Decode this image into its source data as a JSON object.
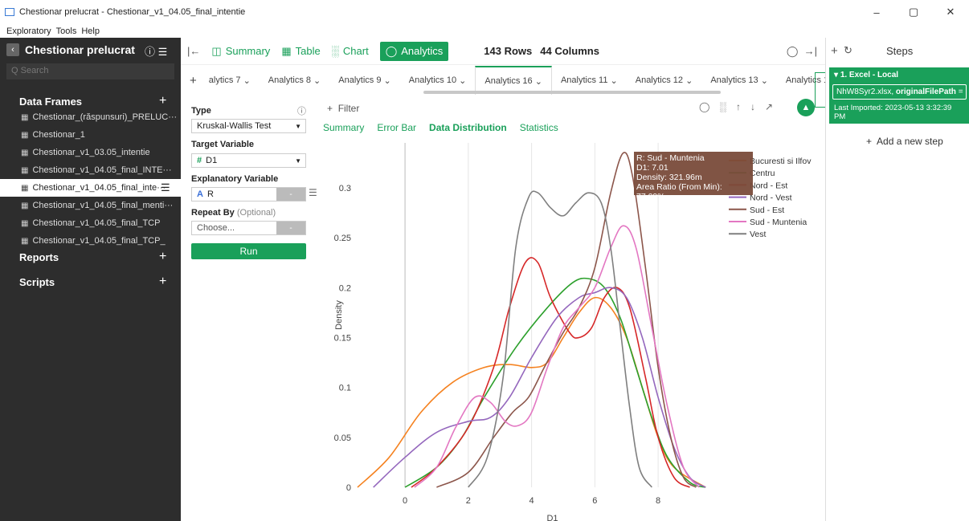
{
  "window": {
    "title": "Chestionar prelucrat - Chestionar_v1_04.05_final_intentie",
    "min": "–",
    "max": "▢",
    "close": "✕"
  },
  "menu": [
    "Exploratory",
    "Tools",
    "Help"
  ],
  "sidebar": {
    "project": "Chestionar prelucrat",
    "search_placeholder": "Q Search",
    "data_frames_label": "Data Frames",
    "reports_label": "Reports",
    "scripts_label": "Scripts",
    "items": [
      "Chestionar_(răspunsuri)_PRELUC···",
      "Chestionar_1",
      "Chestionar_v1_03.05_intentie",
      "Chestionar_v1_04.05_final_INTE···",
      "Chestionar_v1_04.05_final_inte···",
      "Chestionar_v1_04.05_final_menti···",
      "Chestionar_v1_04.05_final_TCP",
      "Chestionar_v1_04.05_final_TCP_"
    ]
  },
  "toolbar": {
    "summary": "Summary",
    "table": "Table",
    "chart": "Chart",
    "analytics": "Analytics",
    "rows": "143 Rows",
    "cols": "44 Columns"
  },
  "tabs": [
    "alytics 7",
    "Analytics 8",
    "Analytics 9",
    "Analytics 10",
    "Analytics 16",
    "Analytics 11",
    "Analytics 12",
    "Analytics 13",
    "Analytics 14"
  ],
  "config": {
    "type_label": "Type",
    "type_value": "Kruskal-Wallis Test",
    "target_label": "Target Variable",
    "target_value": "D1",
    "explanatory_label": "Explanatory Variable",
    "explanatory_value": "R",
    "repeat_label": "Repeat By",
    "repeat_optional": "(Optional)",
    "repeat_placeholder": "Choose...",
    "run_label": "Run"
  },
  "chart_header": {
    "filter": "Filter",
    "subtabs": [
      "Summary",
      "Error Bar",
      "Data Distribution",
      "Statistics"
    ]
  },
  "tooltip": {
    "line1": "R: Sud - Muntenia",
    "line2": "D1: 7.01",
    "line3": "Density: 321.96m",
    "line4": "Area Ratio (From Min): 77.09%"
  },
  "chart_data": {
    "type": "line",
    "xlabel": "D1",
    "ylabel": "Density",
    "xlim": [
      -1.5,
      9.8
    ],
    "ylim": [
      0,
      0.345
    ],
    "xticks": [
      0,
      2,
      4,
      6,
      8
    ],
    "yticks": [
      0,
      0.05,
      0.1,
      0.15,
      0.2,
      0.25,
      0.3
    ],
    "series": [
      {
        "name": "Bucuresti si Ilfov",
        "color": "#f58220",
        "points": [
          [
            -1.5,
            0.0
          ],
          [
            -0.5,
            0.03
          ],
          [
            0.5,
            0.075
          ],
          [
            1.5,
            0.105
          ],
          [
            2.5,
            0.12
          ],
          [
            3.3,
            0.123
          ],
          [
            4,
            0.12
          ],
          [
            4.5,
            0.125
          ],
          [
            5,
            0.15
          ],
          [
            5.5,
            0.175
          ],
          [
            6,
            0.19
          ],
          [
            6.5,
            0.18
          ],
          [
            7,
            0.15
          ],
          [
            7.5,
            0.1
          ],
          [
            8,
            0.05
          ],
          [
            8.5,
            0.02
          ],
          [
            9.5,
            0.0
          ]
        ]
      },
      {
        "name": "Centru",
        "color": "#2ca02c",
        "points": [
          [
            0,
            0.0
          ],
          [
            1,
            0.02
          ],
          [
            1.8,
            0.05
          ],
          [
            2.5,
            0.09
          ],
          [
            3.5,
            0.14
          ],
          [
            4.5,
            0.18
          ],
          [
            5.3,
            0.205
          ],
          [
            5.8,
            0.209
          ],
          [
            6.3,
            0.2
          ],
          [
            6.8,
            0.17
          ],
          [
            7.3,
            0.12
          ],
          [
            7.8,
            0.07
          ],
          [
            8.3,
            0.03
          ],
          [
            9,
            0.005
          ],
          [
            9.5,
            0.0
          ]
        ]
      },
      {
        "name": "Nord - Est",
        "color": "#d62728",
        "points": [
          [
            0.2,
            0.0
          ],
          [
            1,
            0.02
          ],
          [
            2,
            0.06
          ],
          [
            2.8,
            0.12
          ],
          [
            3.3,
            0.18
          ],
          [
            3.8,
            0.225
          ],
          [
            4.2,
            0.225
          ],
          [
            4.6,
            0.19
          ],
          [
            5.2,
            0.155
          ],
          [
            5.5,
            0.15
          ],
          [
            5.9,
            0.16
          ],
          [
            6.3,
            0.19
          ],
          [
            6.7,
            0.2
          ],
          [
            7.1,
            0.18
          ],
          [
            7.6,
            0.11
          ],
          [
            8,
            0.05
          ],
          [
            8.5,
            0.01
          ],
          [
            9,
            0.0
          ]
        ]
      },
      {
        "name": "Nord - Vest",
        "color": "#9467bd",
        "points": [
          [
            -1,
            0.0
          ],
          [
            0,
            0.03
          ],
          [
            1,
            0.055
          ],
          [
            2,
            0.066
          ],
          [
            2.7,
            0.07
          ],
          [
            3.3,
            0.09
          ],
          [
            4,
            0.13
          ],
          [
            4.8,
            0.17
          ],
          [
            5.5,
            0.19
          ],
          [
            6,
            0.195
          ],
          [
            6.5,
            0.2
          ],
          [
            7,
            0.19
          ],
          [
            7.5,
            0.15
          ],
          [
            8,
            0.09
          ],
          [
            8.5,
            0.04
          ],
          [
            9,
            0.01
          ],
          [
            9.5,
            0.0
          ]
        ]
      },
      {
        "name": "Sud - Est",
        "color": "#8c564b",
        "points": [
          [
            1,
            0.0
          ],
          [
            2,
            0.015
          ],
          [
            2.8,
            0.05
          ],
          [
            3.4,
            0.075
          ],
          [
            3.9,
            0.09
          ],
          [
            4.4,
            0.12
          ],
          [
            5,
            0.155
          ],
          [
            5.5,
            0.18
          ],
          [
            6,
            0.22
          ],
          [
            6.5,
            0.295
          ],
          [
            6.9,
            0.335
          ],
          [
            7.2,
            0.31
          ],
          [
            7.6,
            0.22
          ],
          [
            8,
            0.12
          ],
          [
            8.4,
            0.05
          ],
          [
            8.8,
            0.01
          ],
          [
            9.2,
            0.0
          ]
        ]
      },
      {
        "name": "Sud - Muntenia",
        "color": "#e377c2",
        "points": [
          [
            0.3,
            0.0
          ],
          [
            1,
            0.02
          ],
          [
            1.6,
            0.06
          ],
          [
            2.2,
            0.09
          ],
          [
            2.7,
            0.085
          ],
          [
            3.2,
            0.065
          ],
          [
            3.6,
            0.062
          ],
          [
            4,
            0.075
          ],
          [
            4.5,
            0.12
          ],
          [
            5,
            0.16
          ],
          [
            5.5,
            0.18
          ],
          [
            6,
            0.2
          ],
          [
            6.5,
            0.24
          ],
          [
            6.9,
            0.262
          ],
          [
            7.3,
            0.24
          ],
          [
            7.8,
            0.16
          ],
          [
            8.3,
            0.08
          ],
          [
            8.8,
            0.02
          ],
          [
            9.3,
            0.0
          ]
        ]
      },
      {
        "name": "Vest",
        "color": "#7f7f7f",
        "points": [
          [
            2,
            0.0
          ],
          [
            2.6,
            0.03
          ],
          [
            3.1,
            0.11
          ],
          [
            3.5,
            0.24
          ],
          [
            3.9,
            0.29
          ],
          [
            4.2,
            0.295
          ],
          [
            4.6,
            0.28
          ],
          [
            5,
            0.272
          ],
          [
            5.4,
            0.285
          ],
          [
            5.8,
            0.295
          ],
          [
            6.2,
            0.285
          ],
          [
            6.5,
            0.24
          ],
          [
            6.8,
            0.16
          ],
          [
            7.1,
            0.08
          ],
          [
            7.4,
            0.02
          ],
          [
            7.8,
            0.0
          ]
        ]
      }
    ],
    "legend_position": "right"
  },
  "right_panel": {
    "title": "Steps",
    "step_title": "1. Excel - Local",
    "step_file_name": "NhW8Syr2.xlsx, ",
    "step_file_key": "originalFilePath",
    "step_file_rest": " = ...",
    "step_imported": "Last Imported: 2023-05-13 3:32:39 PM",
    "add_step": "Add a new step"
  }
}
